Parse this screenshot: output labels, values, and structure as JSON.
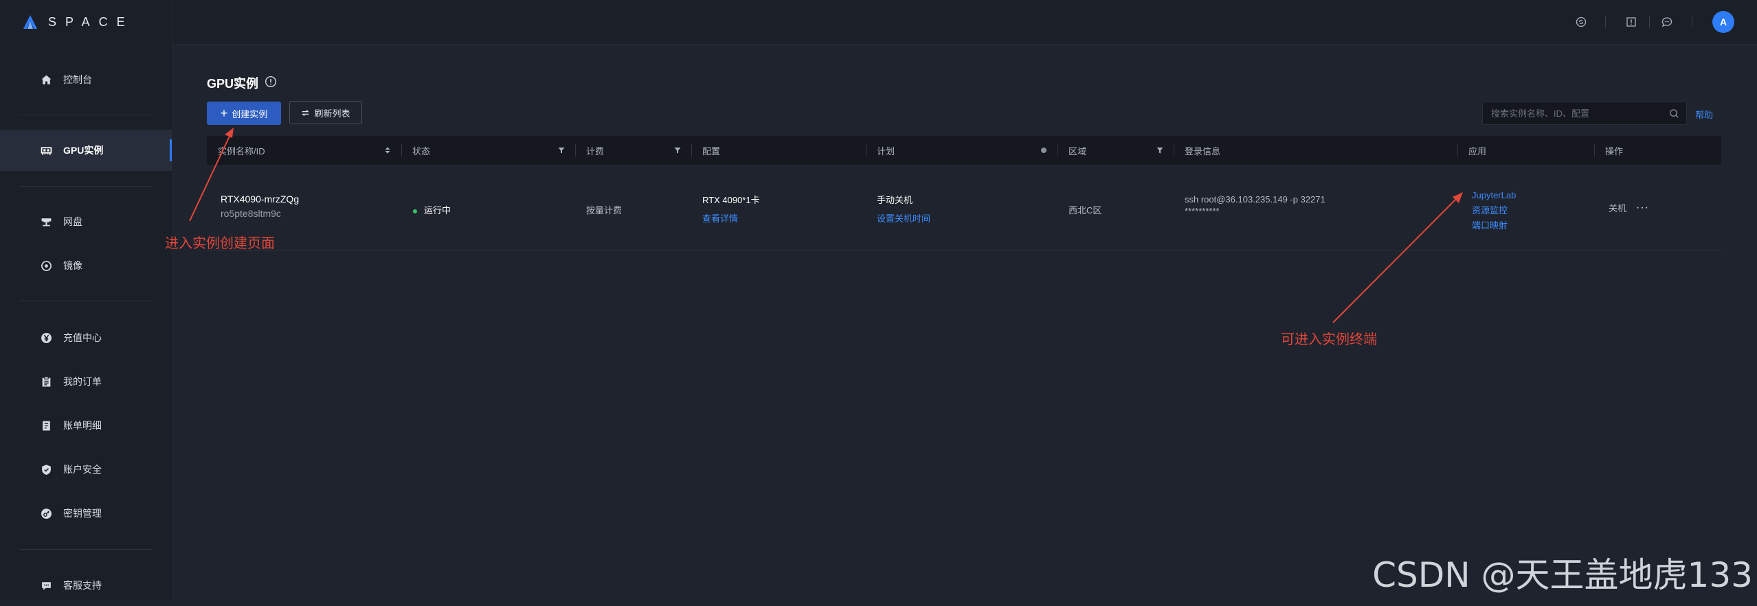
{
  "brand": {
    "name": "SPACE"
  },
  "sidebar": {
    "items": [
      {
        "label": "控制台",
        "icon": "home-icon"
      },
      {
        "label": "GPU实例",
        "icon": "gpu-instance-icon",
        "active": true
      },
      {
        "label": "网盘",
        "icon": "cloud-disk-icon"
      },
      {
        "label": "镜像",
        "icon": "image-disc-icon"
      },
      {
        "label": "充值中心",
        "icon": "yen-coin-icon"
      },
      {
        "label": "我的订单",
        "icon": "clipboard-icon"
      },
      {
        "label": "账单明细",
        "icon": "bill-icon"
      },
      {
        "label": "账户安全",
        "icon": "shield-icon"
      },
      {
        "label": "密钥管理",
        "icon": "key-icon"
      },
      {
        "label": "客服支持",
        "icon": "chat-icon"
      }
    ]
  },
  "header": {
    "icons": [
      "refresh-circle-icon",
      "notice-icon",
      "message-icon"
    ],
    "avatar_initial": "A"
  },
  "main": {
    "title": "GPU实例",
    "create_label": "创建实例",
    "refresh_label": "刷新列表",
    "search_placeholder": "搜索实例名称、ID、配置",
    "help_label": "帮助",
    "columns": [
      "实例名称/ID",
      "状态",
      "计费",
      "配置",
      "计划",
      "区域",
      "登录信息",
      "应用",
      "操作"
    ],
    "rows": [
      {
        "name": "RTX4090-mrzZQg",
        "id": "ro5pte8sltm9c",
        "status": "运行中",
        "billing": "按量计费",
        "config": "RTX 4090*1卡",
        "config_link": "查看详情",
        "plan": "手动关机",
        "plan_link": "设置关机时间",
        "region": "西北C区",
        "login_cmd": "ssh root@36.103.235.149 -p 32271",
        "login_pwd": "**********",
        "apps": [
          "JupyterLab",
          "资源监控",
          "端口映射"
        ],
        "action": "关机",
        "more": "···"
      }
    ]
  },
  "annotations": {
    "create_note": "进入实例创建页面",
    "terminal_note": "可进入实例终端",
    "color": "#e2473b"
  },
  "watermark": "CSDN @天王盖地虎133",
  "colors": {
    "accent": "#2e7cf6",
    "link": "#3b8cff",
    "status_running": "#3ac569",
    "background": "#1f232d",
    "sidebar": "#1b1f27"
  }
}
